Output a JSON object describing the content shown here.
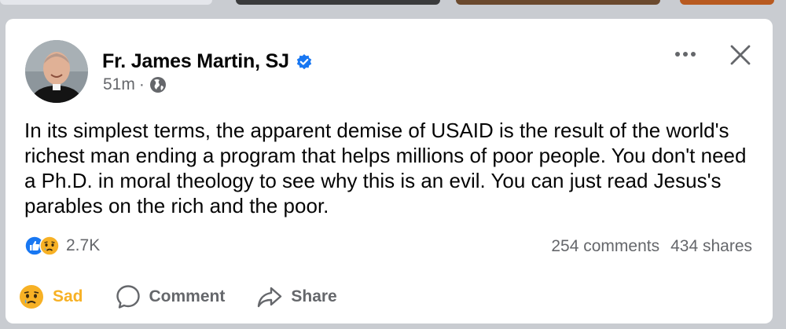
{
  "post": {
    "author": "Fr. James Martin, SJ",
    "time": "51m",
    "separator": "·",
    "audience_icon": "globe-icon",
    "verified_icon": "verified-badge-icon",
    "text": "In its simplest terms, the apparent demise of USAID is the result of the world's richest man ending a program that helps millions of poor people. You don't need a Ph.D. in moral theology to see why this is an evil. You can just read Jesus's parables on the rich and the poor."
  },
  "stats": {
    "reactions_count": "2.7K",
    "reaction_icons": [
      "like-icon",
      "sad-icon"
    ],
    "comments": "254 comments",
    "shares": "434 shares"
  },
  "actions": {
    "reaction_label": "Sad",
    "comment_label": "Comment",
    "share_label": "Share"
  },
  "colors": {
    "brand_blue": "#1877f2",
    "sad_yellow": "#f7b125",
    "secondary_text": "#65676b",
    "primary_text": "#050505"
  }
}
